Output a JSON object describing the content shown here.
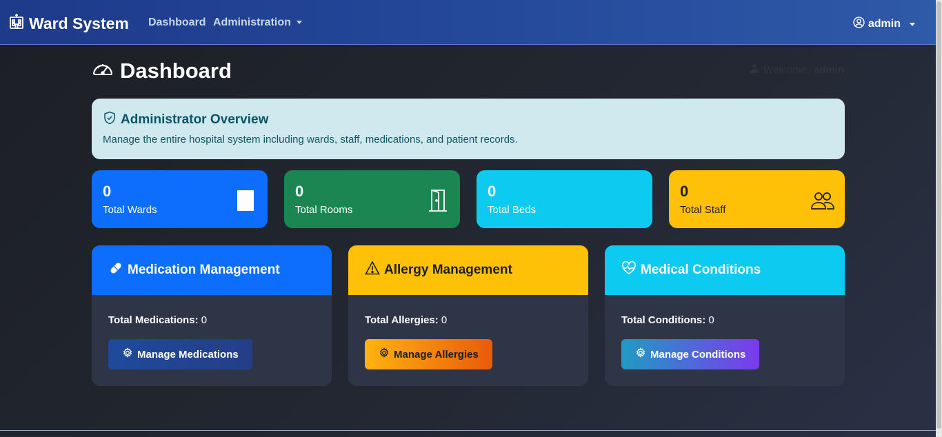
{
  "navbar": {
    "brand": "Ward System",
    "links": [
      "Dashboard",
      "Administration"
    ],
    "user": "admin"
  },
  "page": {
    "title": "Dashboard",
    "welcome_prefix": "Welcome,",
    "welcome_user": "admin"
  },
  "overview": {
    "title": "Administrator Overview",
    "text": "Manage the entire hospital system including wards, staff, medications, and patient records."
  },
  "stats": [
    {
      "value": "0",
      "label": "Total Wards",
      "color": "#0d6efd",
      "icon": "ward-icon"
    },
    {
      "value": "0",
      "label": "Total Rooms",
      "color": "#198754",
      "icon": "door-icon"
    },
    {
      "value": "0",
      "label": "Total Beds",
      "color": "#0dcaf0",
      "icon": "bed-icon"
    },
    {
      "value": "0",
      "label": "Total Staff",
      "color": "#ffc107",
      "icon": "people-icon"
    }
  ],
  "cards": [
    {
      "title": "Medication Management",
      "count_label": "Total Medications:",
      "count": "0",
      "button": "Manage Medications",
      "color": "#0d6efd",
      "icon": "capsule-icon"
    },
    {
      "title": "Allergy Management",
      "count_label": "Total Allergies:",
      "count": "0",
      "button": "Manage Allergies",
      "color": "#ffc107",
      "icon": "warning-icon"
    },
    {
      "title": "Medical Conditions",
      "count_label": "Total Conditions:",
      "count": "0",
      "button": "Manage Conditions",
      "color": "#0dcaf0",
      "icon": "heart-pulse-icon"
    }
  ]
}
